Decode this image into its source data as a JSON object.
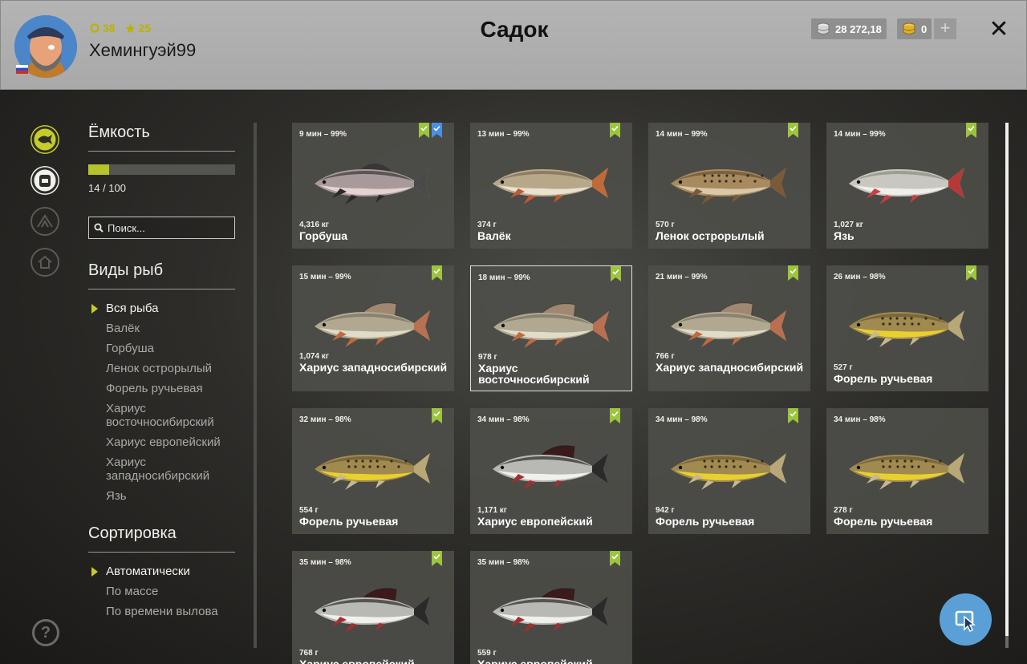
{
  "header": {
    "title": "Садок",
    "username": "Хемингуэй99",
    "level": "38",
    "rank": "25",
    "silver": "28 272,18",
    "gold": "0"
  },
  "sidebar": {
    "capacity_heading": "Ёмкость",
    "capacity_text": "14 / 100",
    "capacity_fraction": 0.14,
    "search_placeholder": "Поиск...",
    "species_heading": "Виды рыб",
    "species": [
      "Вся рыба",
      "Валёк",
      "Горбуша",
      "Ленок острорылый",
      "Форель ручьевая",
      "Хариус восточносибирский",
      "Хариус европейский",
      "Хариус западносибирский",
      "Язь"
    ],
    "sort_heading": "Сортировка",
    "sort_options": [
      "Автоматически",
      "По массе",
      "По времени вылова"
    ]
  },
  "catches": [
    {
      "time": "9 мин – 99%",
      "weight": "4,316 кг",
      "name": "Горбуша",
      "fish": "pink-salmon",
      "badges": [
        "green",
        "blue"
      ]
    },
    {
      "time": "13 мин – 99%",
      "weight": "374 г",
      "name": "Валёк",
      "fish": "round-whitefish",
      "badges": [
        "green"
      ]
    },
    {
      "time": "14 мин – 99%",
      "weight": "570 г",
      "name": "Ленок острорылый",
      "fish": "lenok",
      "badges": [
        "green"
      ]
    },
    {
      "time": "14 мин – 99%",
      "weight": "1,027 кг",
      "name": "Язь",
      "fish": "ide",
      "badges": [
        "green"
      ]
    },
    {
      "time": "15 мин – 99%",
      "weight": "1,074 кг",
      "name": "Хариус западносибирский",
      "fish": "grayling",
      "badges": [
        "green"
      ]
    },
    {
      "time": "18 мин – 99%",
      "weight": "978 г",
      "name": "Хариус восточносибирский",
      "fish": "grayling",
      "badges": [
        "green"
      ]
    },
    {
      "time": "21 мин – 99%",
      "weight": "766 г",
      "name": "Хариус западносибирский",
      "fish": "grayling",
      "badges": [
        "green"
      ]
    },
    {
      "time": "26 мин – 98%",
      "weight": "527 г",
      "name": "Форель ручьевая",
      "fish": "trout",
      "badges": [
        "green"
      ]
    },
    {
      "time": "32 мин – 98%",
      "weight": "554 г",
      "name": "Форель ручьевая",
      "fish": "trout",
      "badges": [
        "green"
      ]
    },
    {
      "time": "34 мин – 98%",
      "weight": "1,171 кг",
      "name": "Хариус европейский",
      "fish": "european-grayling",
      "badges": [
        "green"
      ]
    },
    {
      "time": "34 мин – 98%",
      "weight": "942 г",
      "name": "Форель ручьевая",
      "fish": "trout",
      "badges": [
        "green"
      ]
    },
    {
      "time": "34 мин – 98%",
      "weight": "278 г",
      "name": "Форель ручьевая",
      "fish": "trout",
      "badges": []
    },
    {
      "time": "35 мин – 98%",
      "weight": "768 г",
      "name": "Хариус европейский",
      "fish": "european-grayling",
      "badges": [
        "green"
      ]
    },
    {
      "time": "35 мин – 98%",
      "weight": "559 г",
      "name": "Хариус европейский",
      "fish": "european-grayling",
      "badges": [
        "green"
      ]
    }
  ],
  "selected_index": 5,
  "colors": {
    "accent": "#b4c42a",
    "badge_green": "#9bc53d",
    "badge_blue": "#4a90e2",
    "cursor_button": "#5aa0d6"
  },
  "icons": {
    "rail": [
      "fish-keepnet-icon",
      "backpack-icon",
      "tent-icon",
      "home-icon"
    ],
    "help": "help-icon",
    "cursor": "cursor-icon"
  }
}
